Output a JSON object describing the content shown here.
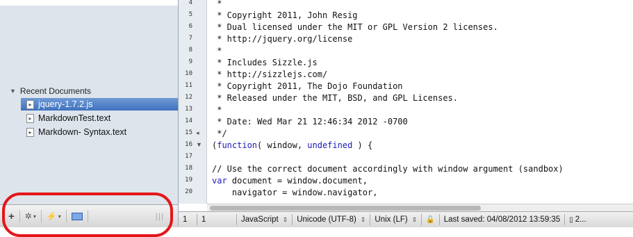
{
  "sidebar": {
    "group_header": "Recent Documents",
    "items": [
      {
        "label": "jquery-1.7.2.js",
        "selected": true
      },
      {
        "label": "MarkdownTest.text",
        "selected": false
      },
      {
        "label": "Markdown- Syntax.text",
        "selected": false
      }
    ],
    "toolbar": {
      "add_label": "+",
      "gear_label": "✲",
      "action_label": "⚡",
      "grip_label": "|||"
    }
  },
  "gutter": {
    "lines": [
      "4",
      "5",
      "6",
      "7",
      "8",
      "9",
      "10",
      "11",
      "12",
      "13",
      "14",
      "15",
      "16",
      "17",
      "18",
      "19",
      "20"
    ],
    "fold_markers": [
      {
        "line": "15",
        "glyph": "◂"
      },
      {
        "line": "16",
        "glyph": "▼"
      }
    ]
  },
  "code": {
    "lines": [
      " *",
      " * Copyright 2011, John Resig",
      " * Dual licensed under the MIT or GPL Version 2 licenses.",
      " * http://jquery.org/license",
      " *",
      " * Includes Sizzle.js",
      " * http://sizzlejs.com/",
      " * Copyright 2011, The Dojo Foundation",
      " * Released under the MIT, BSD, and GPL Licenses.",
      " *",
      " * Date: Wed Mar 21 12:46:34 2012 -0700",
      " */",
      "(function( window, undefined ) {",
      "",
      "// Use the correct document accordingly with window argument (sandbox)",
      "var document = window.document,",
      "    navigator = window.navigator,"
    ]
  },
  "statusbar": {
    "line": "1",
    "column": "1",
    "syntax": "JavaScript",
    "encoding": "Unicode (UTF-8)",
    "line_endings": "Unix (LF)",
    "last_saved": "Last saved: 04/08/2012 13:59:35",
    "doc_label": "2..."
  },
  "colors": {
    "annotation_ring": "#e3161b",
    "selection": "#3f71c0",
    "keyword": "#1a1ab8"
  }
}
